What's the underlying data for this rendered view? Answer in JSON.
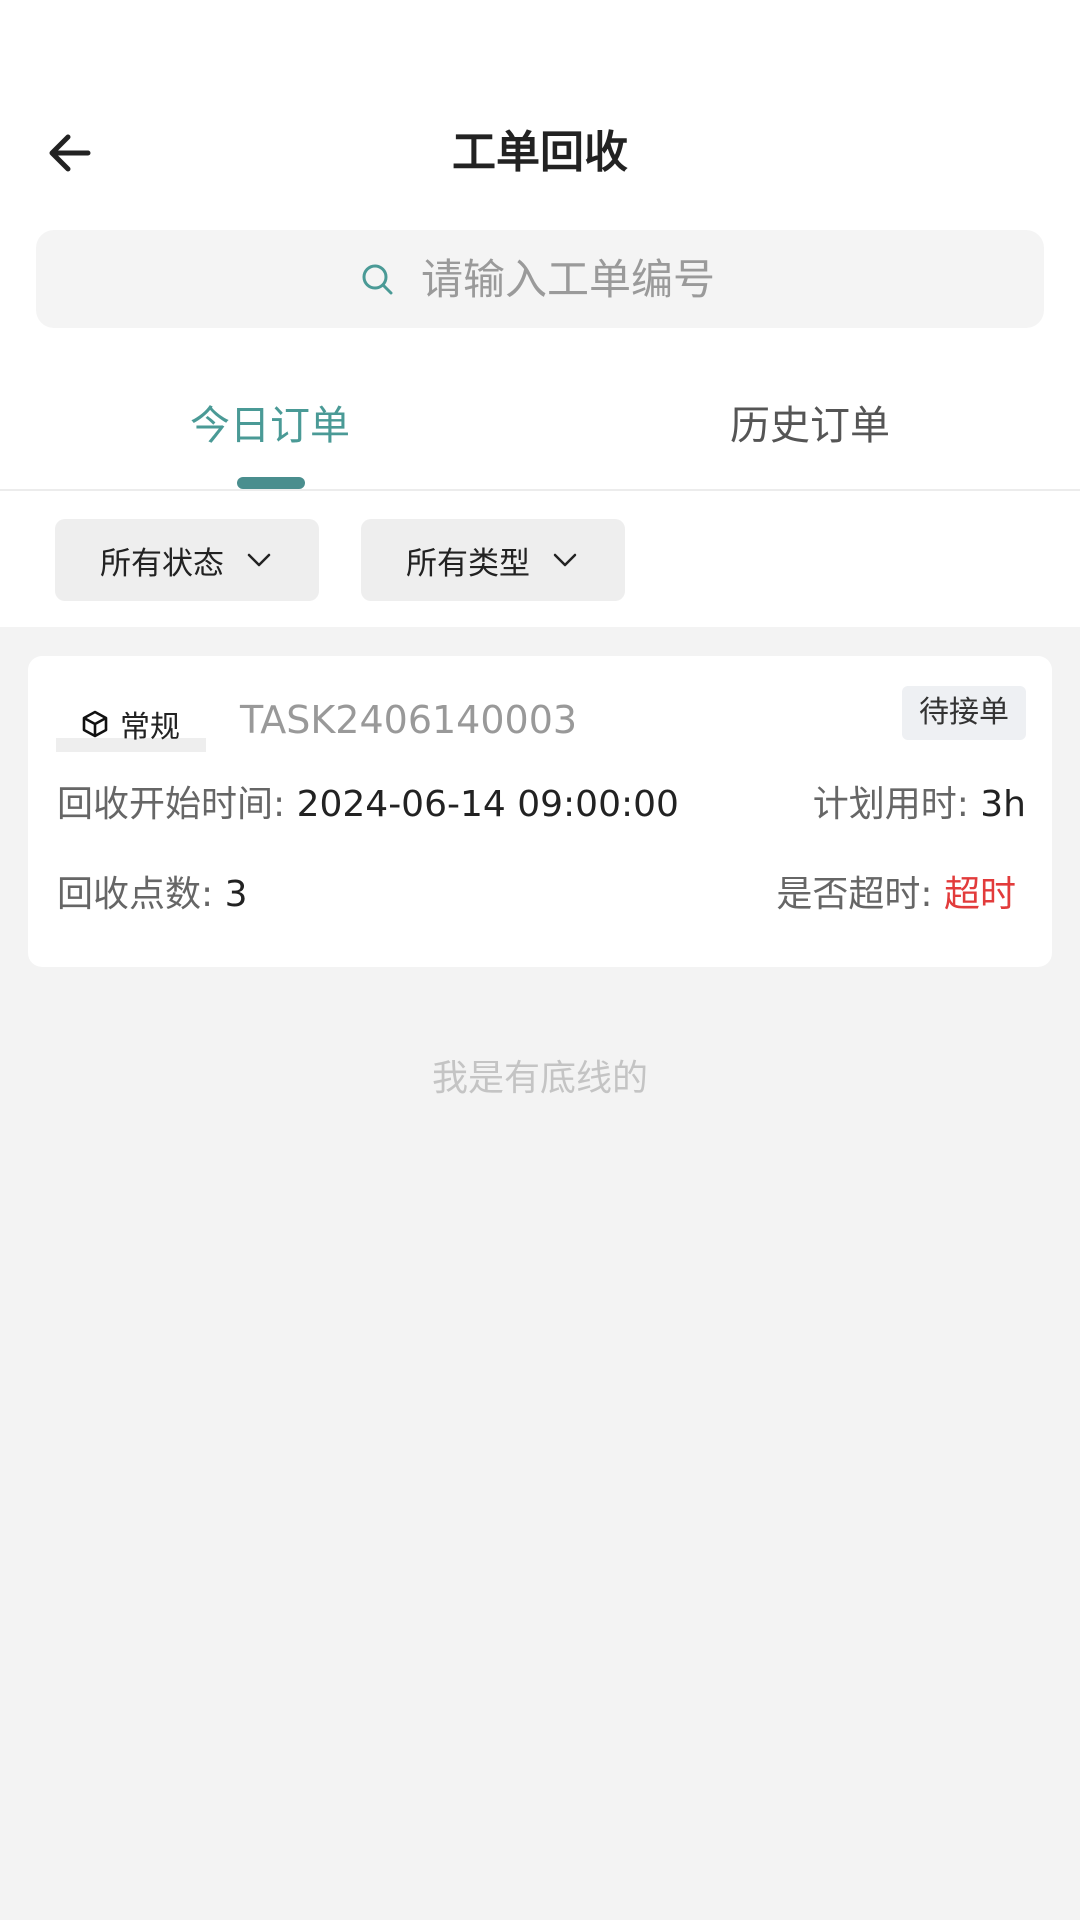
{
  "header": {
    "title": "工单回收"
  },
  "search": {
    "placeholder": "请输入工单编号",
    "value": ""
  },
  "tabs": [
    {
      "label": "今日订单",
      "active": true
    },
    {
      "label": "历史订单",
      "active": false
    }
  ],
  "filters": {
    "status_label": "所有状态",
    "type_label": "所有类型"
  },
  "orders": [
    {
      "type_tag": "常规",
      "order_no": "TASK2406140003",
      "status": "待接单",
      "start_time_label": "回收开始时间: ",
      "start_time": "2024-06-14 09:00:00",
      "plan_time_label": "计划用时: ",
      "plan_time": "3h",
      "points_label": "回收点数: ",
      "points": "3",
      "timeout_label": "是否超时: ",
      "timeout": "超时"
    }
  ],
  "footer": {
    "end_text": "我是有底线的"
  },
  "colors": {
    "accent": "#4a9a96",
    "timeout": "#e23b3b",
    "background": "#f3f3f3"
  },
  "icons": {
    "back": "arrow-left-icon",
    "search": "search-icon",
    "dropdown": "chevron-down-icon",
    "type_tag": "cube-icon"
  }
}
